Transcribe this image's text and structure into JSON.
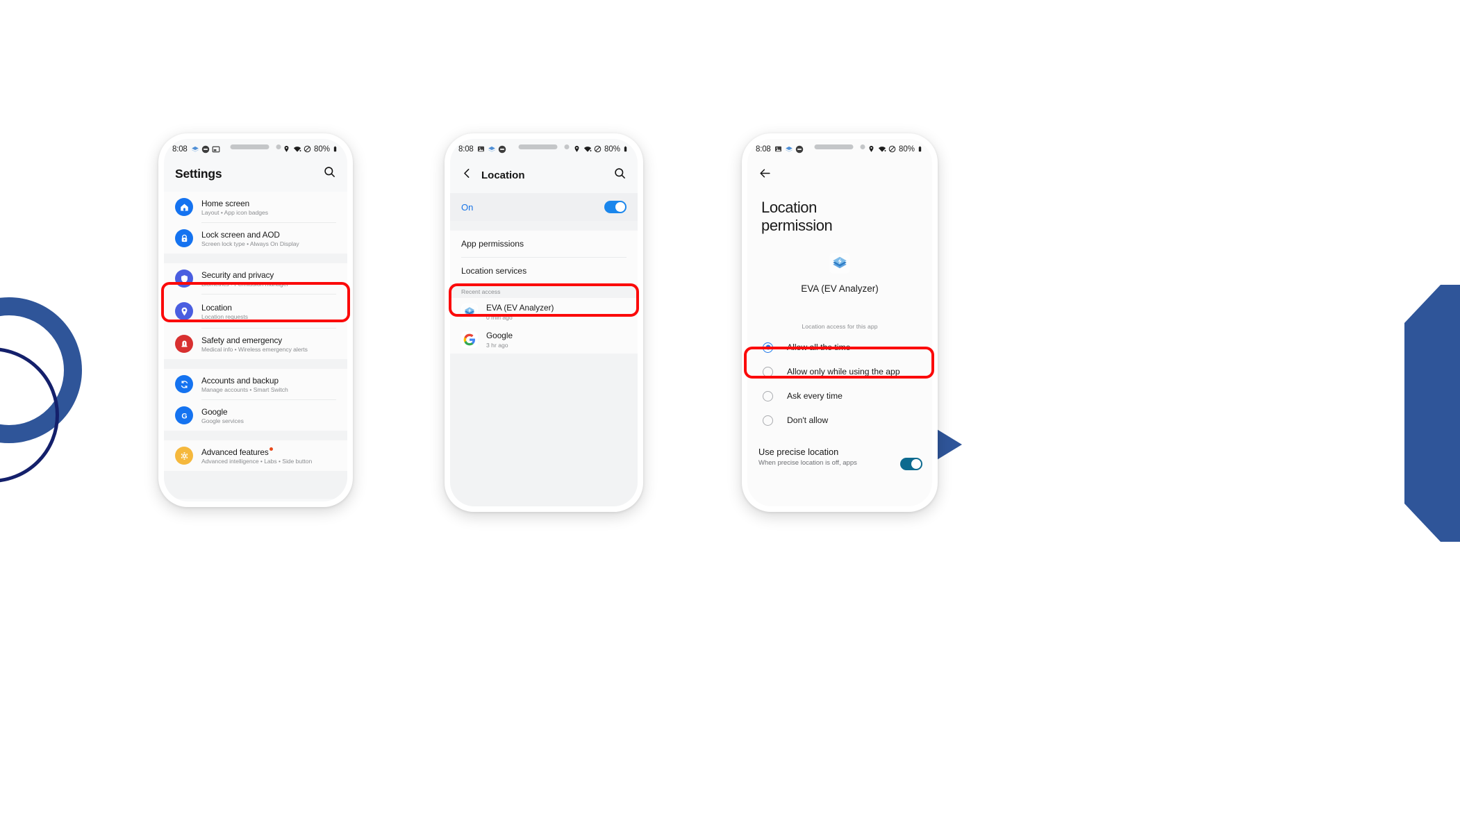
{
  "theme": {
    "accent_blue": "#2f5599",
    "dark_navy": "#14206b",
    "highlight_red": "#fb0a0a",
    "toggle_blue": "#1a86ec",
    "link_blue": "#1773e6"
  },
  "statusbar": {
    "time": "8:08",
    "battery": "80%",
    "left_icons": [
      "gallery-icon",
      "layers-icon",
      "mute-icon",
      "card-icon"
    ],
    "right_icons": [
      "location-pin-icon",
      "wifi-icon",
      "no-sound-icon",
      "battery-icon"
    ]
  },
  "phone1": {
    "title": "Settings",
    "search_icon": "search-icon",
    "items": [
      {
        "title": "Home screen",
        "sub": "Layout  •  App icon badges",
        "icon": "home-icon",
        "icon_bg": "#1573f0"
      },
      {
        "title": "Lock screen and AOD",
        "sub": "Screen lock type  •  Always On Display",
        "icon": "lock-icon",
        "icon_bg": "#1573f0"
      },
      {
        "title": "Security and privacy",
        "sub": "Biometrics  •  Permission manager",
        "icon": "shield-icon",
        "icon_bg": "#4a5ee0"
      },
      {
        "title": "Location",
        "sub": "Location requests",
        "icon": "location-pin-icon",
        "icon_bg": "#4a5ee0"
      },
      {
        "title": "Safety and emergency",
        "sub": "Medical info  •  Wireless emergency alerts",
        "icon": "alert-icon",
        "icon_bg": "#d83030"
      },
      {
        "title": "Accounts and backup",
        "sub": "Manage accounts  •  Smart Switch",
        "icon": "sync-icon",
        "icon_bg": "#1573f0"
      },
      {
        "title": "Google",
        "sub": "Google services",
        "icon": "google-g-icon",
        "icon_bg": "#1573f0"
      },
      {
        "title": "Advanced features",
        "sub": "Advanced intelligence  •  Labs  •  Side button",
        "icon": "gear-icon",
        "icon_bg": "#f5b83d",
        "badge": true
      }
    ]
  },
  "phone2": {
    "back_icon": "chevron-left-icon",
    "title": "Location",
    "search_icon": "search-icon",
    "toggle_label": "On",
    "toggle_on": true,
    "menu": [
      "App permissions",
      "Location services"
    ],
    "recent_label": "Recent access",
    "recent": [
      {
        "name": "EVA (EV Analyzer)",
        "time": "0 min ago",
        "icon": "eva-app-icon"
      },
      {
        "name": "Google",
        "time": "3 hr ago",
        "icon": "google-g-icon"
      }
    ]
  },
  "phone3": {
    "back_icon": "arrow-left-icon",
    "title": "Location\npermission",
    "title_line1": "Location",
    "title_line2": "permission",
    "app_icon": "eva-app-icon",
    "app_name": "EVA (EV Analyzer)",
    "access_label": "Location access for this app",
    "options": [
      {
        "label": "Allow all the time",
        "selected": true
      },
      {
        "label": "Allow only while using the app",
        "selected": false
      },
      {
        "label": "Ask every time",
        "selected": false
      },
      {
        "label": "Don't allow",
        "selected": false
      }
    ],
    "precise_title": "Use precise location",
    "precise_sub": "When precise location is off, apps",
    "precise_on": true
  }
}
